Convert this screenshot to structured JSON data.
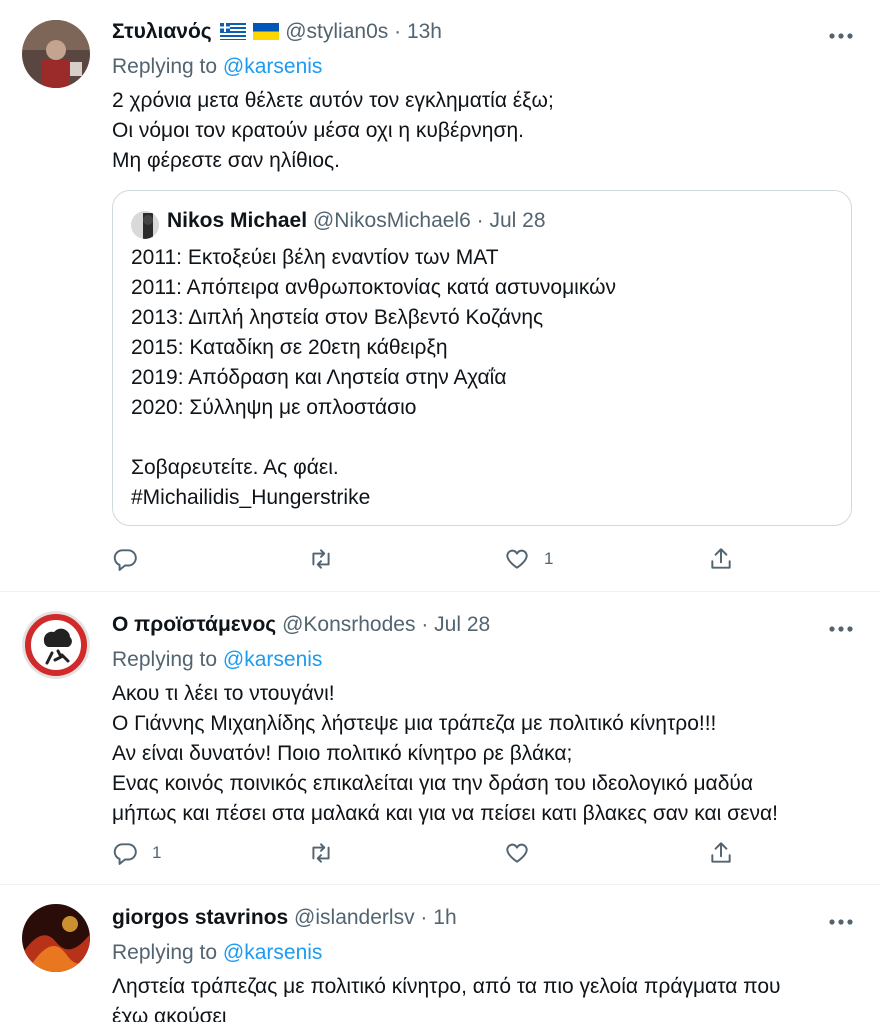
{
  "tweets": [
    {
      "name": "Στυλιανός",
      "handle": "@stylian0s",
      "separator": "·",
      "time": "13h",
      "replying_prefix": "Replying to ",
      "replying_to": "@karsenis",
      "text": "2 χρόνια μετα θέλετε αυτόν τον εγκληματία έξω;\nΟι νόμοι τον κρατούν μέσα οχι η κυβέρνηση.\nΜη φέρεστε σαν ηλίθιος.",
      "quote": {
        "name": "Nikos Michael",
        "handle": "@NikosMichael6",
        "separator": "·",
        "time": "Jul 28",
        "text": "2011: Εκτοξεύει βέλη εναντίον των ΜΑΤ\n2011: Απόπειρα ανθρωποκτονίας κατά αστυνομικών\n2013: Διπλή ληστεία στον Βελβεντό Κοζάνης\n2015: Καταδίκη σε 20ετη κάθειρξη\n2019: Απόδραση και Ληστεία στην Αχαΐα\n2020: Σύλληψη με οπλοστάσιο\n\nΣοβαρευτείτε. Ας φάει.",
        "hashtag": "#Michailidis_Hungerstrike"
      },
      "reply_count": "",
      "retweet_count": "",
      "like_count": "1"
    },
    {
      "name": "Ο προϊστάμενος",
      "handle": "@Konsrhodes",
      "separator": "·",
      "time": "Jul 28",
      "replying_prefix": "Replying to ",
      "replying_to": "@karsenis",
      "text": "Ακου τι λέει το ντουγάνι!\nΟ Γιάννης Μιχαηλίδης λήστεψε μια τράπεζα με πολιτικό κίνητρο!!!\nΑν είναι δυνατόν! Ποιο πολιτικό κίνητρο ρε βλάκα;\nΕνας κοινός ποινικός επικαλείται για την δράση του ιδεολογικό μαδύα\nμήπως και πέσει στα μαλακά και για να πείσει κατι βλακες σαν και σενα!",
      "reply_count": "1",
      "retweet_count": "",
      "like_count": ""
    },
    {
      "name": "giorgos stavrinos",
      "handle": "@islanderlsv",
      "separator": "·",
      "time": "1h",
      "replying_prefix": "Replying to ",
      "replying_to": "@karsenis",
      "text": "Ληστεία τράπεζας με πολιτικό κίνητρο, από τα πιο γελοία πράγματα που\nέχω ακούσει"
    }
  ],
  "colors": {
    "accent": "#1d9bf0",
    "secondary_text": "#536471",
    "border": "#cfd9de"
  },
  "icons": [
    "more-icon",
    "reply-icon",
    "retweet-icon",
    "like-icon",
    "share-icon",
    "greece-flag-icon",
    "ukraine-flag-icon"
  ]
}
